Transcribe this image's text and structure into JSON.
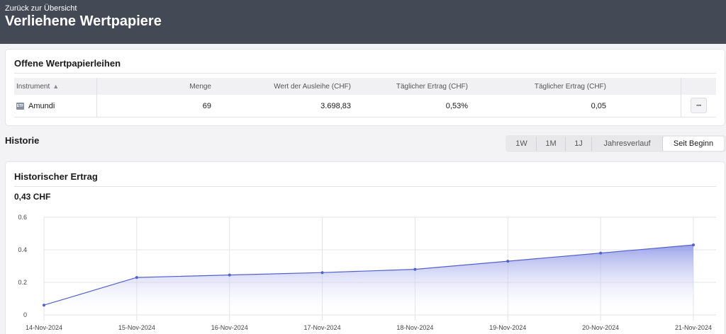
{
  "header": {
    "back_link": "Zurück zur Übersicht",
    "title": "Verliehene Wertpapiere"
  },
  "loans": {
    "title": "Offene Wertpapierleihen",
    "columns": {
      "instrument": "Instrument",
      "menge": "Menge",
      "wert": "Wert der Ausleihe (CHF)",
      "ertrag1": "Täglicher Ertrag (CHF)",
      "ertrag2": "Täglicher Ertrag (CHF)"
    },
    "rows": [
      {
        "icon_label": "ETF",
        "instrument": "Amundi",
        "menge": "69",
        "wert": "3.698,83",
        "ertrag1": "0,53%",
        "ertrag2": "0,05",
        "more": "···"
      }
    ]
  },
  "history": {
    "title": "Historie",
    "ranges": [
      "1W",
      "1M",
      "1J",
      "Jahresverlauf",
      "Seit Beginn"
    ],
    "active_range": "Seit Beginn"
  },
  "chart_card": {
    "title": "Historischer Ertrag",
    "total": "0,43 CHF"
  },
  "colors": {
    "line": "#5260cc",
    "fill_top": "#8a93e6",
    "header_bg": "#434a55"
  },
  "chart_data": {
    "type": "area",
    "x": [
      "14-Nov-2024",
      "15-Nov-2024",
      "16-Nov-2024",
      "17-Nov-2024",
      "18-Nov-2024",
      "19-Nov-2024",
      "20-Nov-2024",
      "21-Nov-2024"
    ],
    "series": [
      {
        "values": [
          0.06,
          0.23,
          0.245,
          0.26,
          0.28,
          0.33,
          0.38,
          0.43
        ]
      }
    ],
    "yticks": [
      "0.6",
      "0.4",
      "0.2",
      "0"
    ],
    "ylim": [
      0,
      0.6
    ],
    "grid": true
  }
}
